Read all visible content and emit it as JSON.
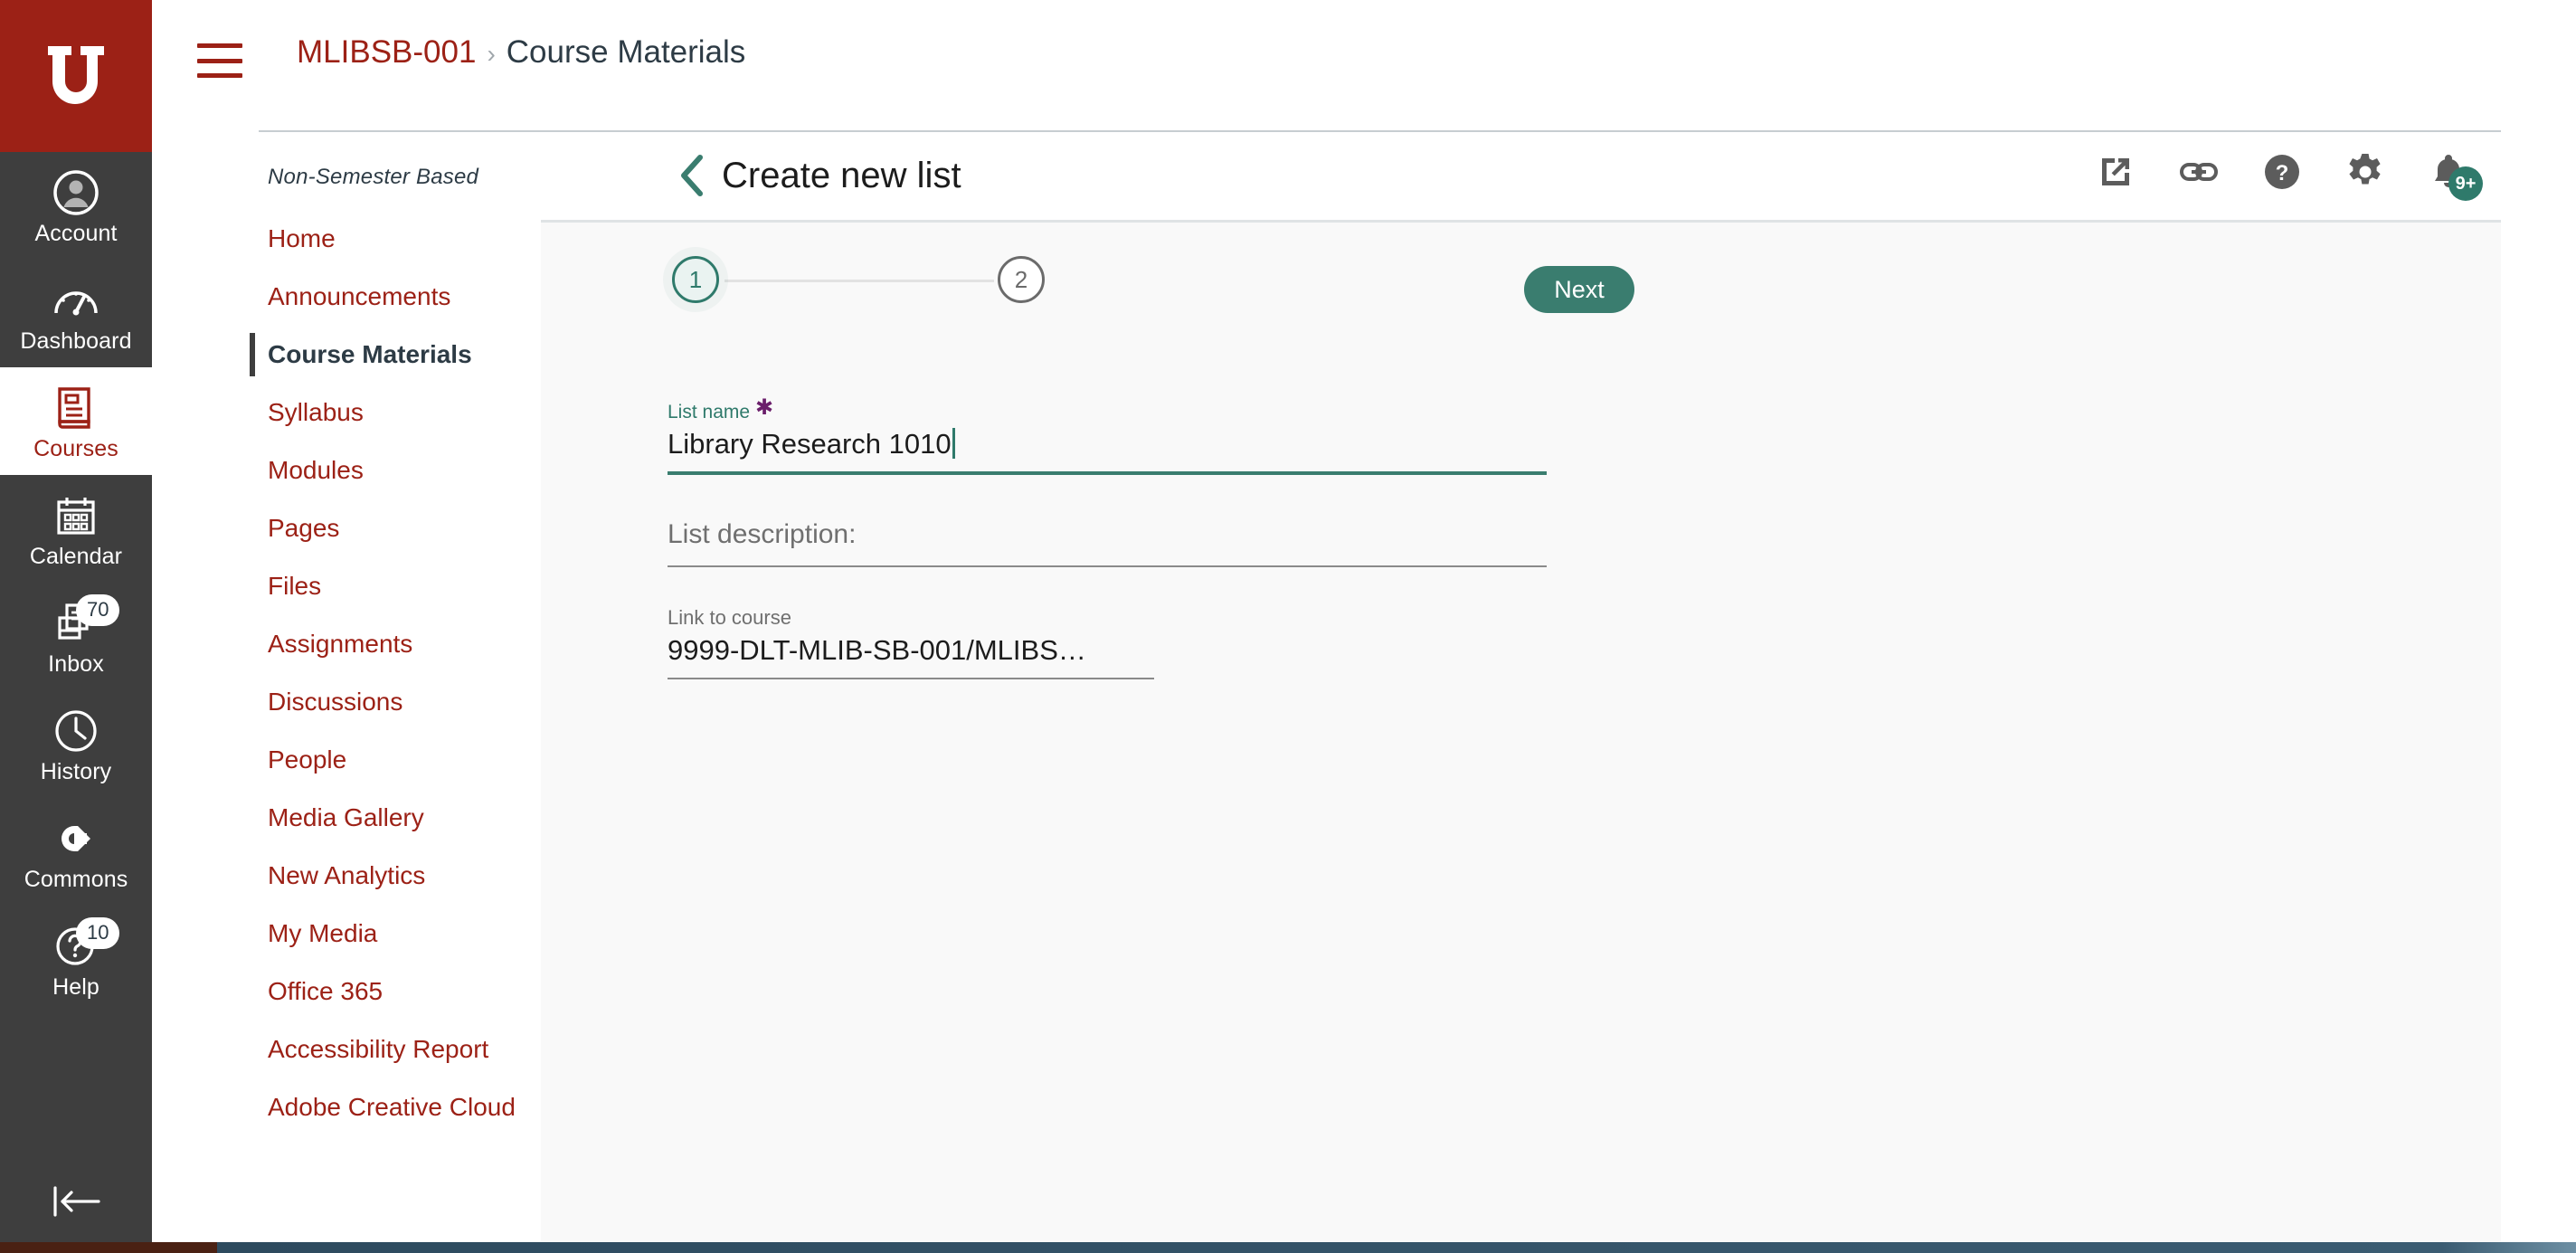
{
  "global_nav": {
    "logo_name": "university-of-utah-u-logo",
    "items": [
      {
        "label": "Account",
        "icon": "user-avatar-icon",
        "active": false,
        "badge": null
      },
      {
        "label": "Dashboard",
        "icon": "dashboard-gauge-icon",
        "active": false,
        "badge": null
      },
      {
        "label": "Courses",
        "icon": "book-icon",
        "active": true,
        "badge": null
      },
      {
        "label": "Calendar",
        "icon": "calendar-icon",
        "active": false,
        "badge": null
      },
      {
        "label": "Inbox",
        "icon": "inbox-icon",
        "active": false,
        "badge": "70"
      },
      {
        "label": "History",
        "icon": "clock-icon",
        "active": false,
        "badge": null
      },
      {
        "label": "Commons",
        "icon": "commons-arrow-icon",
        "active": false,
        "badge": null
      },
      {
        "label": "Help",
        "icon": "help-question-icon",
        "active": false,
        "badge": "10"
      }
    ],
    "collapse_label": "collapse-nav-icon"
  },
  "course_nav": {
    "term": "Non-Semester Based",
    "items": [
      {
        "label": "Home",
        "active": false
      },
      {
        "label": "Announcements",
        "active": false
      },
      {
        "label": "Course Materials",
        "active": true
      },
      {
        "label": "Syllabus",
        "active": false
      },
      {
        "label": "Modules",
        "active": false
      },
      {
        "label": "Pages",
        "active": false
      },
      {
        "label": "Files",
        "active": false
      },
      {
        "label": "Assignments",
        "active": false
      },
      {
        "label": "Discussions",
        "active": false
      },
      {
        "label": "People",
        "active": false
      },
      {
        "label": "Media Gallery",
        "active": false
      },
      {
        "label": "New Analytics",
        "active": false
      },
      {
        "label": "My Media",
        "active": false
      },
      {
        "label": "Office 365",
        "active": false
      },
      {
        "label": "Accessibility Report",
        "active": false
      },
      {
        "label": "Adobe Creative Cloud",
        "active": false
      }
    ]
  },
  "breadcrumb": {
    "course_code": "MLIBSB-001",
    "separator": "›",
    "current": "Course Materials"
  },
  "tool_header": {
    "back_icon": "back-chevron-icon",
    "title": "Create new list",
    "actions": [
      {
        "name": "open-in-new-window-icon"
      },
      {
        "name": "copy-link-icon"
      },
      {
        "name": "help-circle-icon"
      },
      {
        "name": "settings-gear-icon"
      },
      {
        "name": "notifications-bell-icon",
        "badge": "9+"
      }
    ]
  },
  "wizard": {
    "steps": [
      {
        "number": "1",
        "active": true
      },
      {
        "number": "2",
        "active": false
      }
    ],
    "next_label": "Next"
  },
  "form": {
    "list_name": {
      "label": "List name",
      "required_marker": "✱",
      "value": "Library Research 1010",
      "focused": true
    },
    "list_description": {
      "placeholder": "List description:",
      "value": ""
    },
    "link_to_course": {
      "label": "Link to course",
      "value": "9999-DLT-MLIB-SB-001/MLIBS…"
    }
  },
  "colors": {
    "brand_red": "#9c2116",
    "rail_gray": "#3e3e3e",
    "accent_teal": "#3a7d6f",
    "label_teal": "#2f7a6b",
    "required_purple": "#6b1f6b",
    "content_bg": "#f9f9f9",
    "text_dark": "#2d3b45"
  }
}
